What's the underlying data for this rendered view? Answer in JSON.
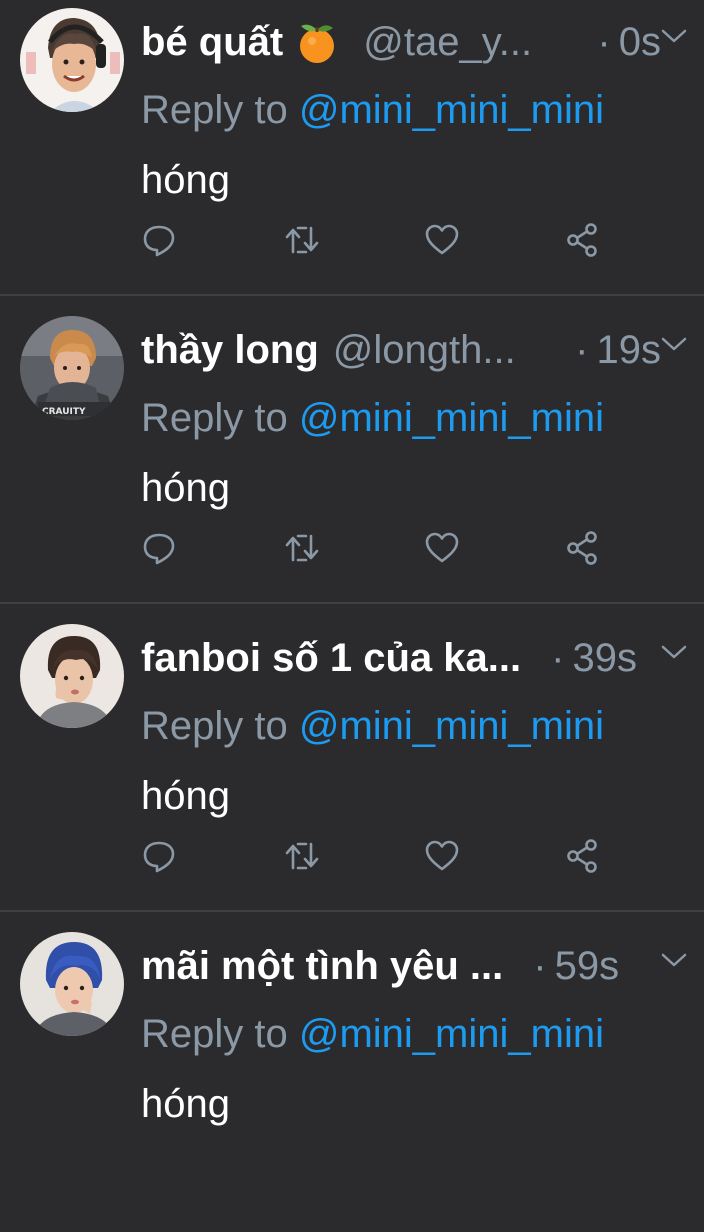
{
  "tweets": [
    {
      "name": "bé quất",
      "emoji": "tangerine",
      "handle": "@tae_y...",
      "dot": "·",
      "time": "0s",
      "reply_prefix": "Reply to",
      "reply_mention": "@mini_mini_mini",
      "text": "hóng"
    },
    {
      "name": "thầy long",
      "handle": "@longth...",
      "dot": "·",
      "time": "19s",
      "reply_prefix": "Reply to",
      "reply_mention": "@mini_mini_mini",
      "text": "hóng"
    },
    {
      "name": "fanboi số 1 của ka...",
      "handle": "",
      "dot": "·",
      "time": "39s",
      "reply_prefix": "Reply to",
      "reply_mention": "@mini_mini_mini",
      "text": "hóng"
    },
    {
      "name": "mãi một tình yêu ...",
      "handle": "",
      "dot": "·",
      "time": "59s",
      "reply_prefix": "Reply to",
      "reply_mention": "@mini_mini_mini",
      "text": "hóng"
    }
  ],
  "icons": [
    "reply-icon",
    "retweet-icon",
    "like-icon",
    "share-icon",
    "chevron-down-icon"
  ],
  "colors": {
    "background": "#2b2b2d",
    "divider": "#3d4146",
    "secondary_text": "#8b98a5",
    "mention": "#1d9bf0",
    "primary_text": "#ffffff"
  }
}
